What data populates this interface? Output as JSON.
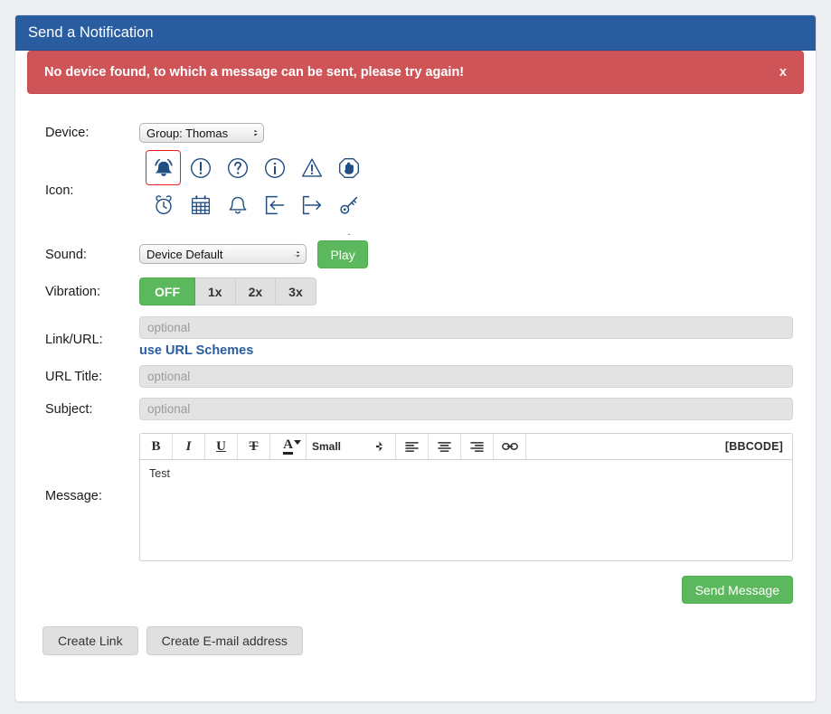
{
  "header": {
    "title": "Send a Notification"
  },
  "alert": {
    "message": "No device found, to which a message can be sent, please try again!",
    "close_label": "x",
    "color": "#cf5458"
  },
  "form": {
    "device": {
      "label": "Device:",
      "selected": "Group: Thomas",
      "options": [
        "Group: Thomas"
      ]
    },
    "icon": {
      "label": "Icon:",
      "selected_index": 0,
      "selected_color": "#f01c16",
      "items": [
        {
          "name": "ringing-bell-icon"
        },
        {
          "name": "exclamation-circle-icon"
        },
        {
          "name": "question-circle-icon"
        },
        {
          "name": "info-circle-icon"
        },
        {
          "name": "warning-triangle-icon"
        },
        {
          "name": "stop-hand-icon"
        },
        {
          "name": "alarm-clock-icon"
        },
        {
          "name": "calendar-icon"
        },
        {
          "name": "bell-icon"
        },
        {
          "name": "arrow-enter-icon"
        },
        {
          "name": "arrow-exit-icon"
        },
        {
          "name": "key-icon"
        },
        {
          "name": "umbrella-icon"
        },
        {
          "name": "dice-icon"
        },
        {
          "name": "footprints-icon"
        },
        {
          "name": "bed-icon"
        },
        {
          "name": "bed-alt-icon"
        },
        {
          "name": "airplane-icon"
        }
      ]
    },
    "sound": {
      "label": "Sound:",
      "selected": "Device Default",
      "options": [
        "Device Default"
      ],
      "play_label": "Play"
    },
    "vibration": {
      "label": "Vibration:",
      "active": "OFF",
      "options": [
        "OFF",
        "1x",
        "2x",
        "3x"
      ]
    },
    "link_url": {
      "label": "Link/URL:",
      "value": "",
      "placeholder": "optional",
      "helper_link": "use URL Schemes"
    },
    "url_title": {
      "label": "URL Title:",
      "value": "",
      "placeholder": "optional"
    },
    "subject": {
      "label": "Subject:",
      "value": "",
      "placeholder": "optional"
    },
    "message": {
      "label": "Message:",
      "body": "Test",
      "bbcode_label": "[BBCODE]",
      "toolbar": {
        "bold": "B",
        "italic": "I",
        "underline": "U",
        "strikethrough": "T",
        "font_color": "A",
        "font_size_selected": "Small",
        "font_size_options": [
          "Small"
        ],
        "align_left": "align-left",
        "align_center": "align-center",
        "align_right": "align-right",
        "link": "link"
      }
    }
  },
  "footer": {
    "send_label": "Send Message",
    "create_link_label": "Create Link",
    "create_email_label": "Create E-mail address",
    "accent_green": "#5cb85c"
  }
}
